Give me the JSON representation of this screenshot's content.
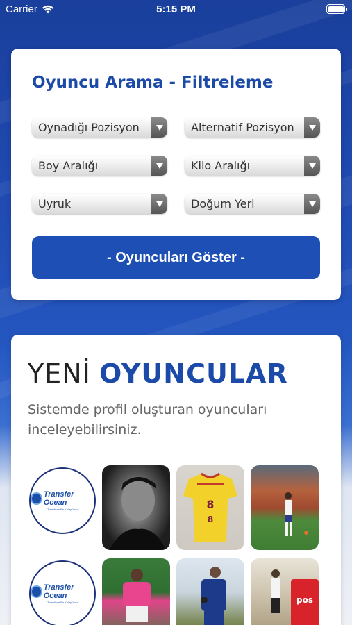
{
  "status_bar": {
    "carrier": "Carrier",
    "time": "5:15 PM"
  },
  "filter": {
    "title": "Oyuncu Arama - Filtreleme",
    "dropdowns": [
      {
        "label": "Oynadığı Pozisyon"
      },
      {
        "label": "Alternatif Pozisyon"
      },
      {
        "label": "Boy Aralığı"
      },
      {
        "label": "Kilo Aralığı"
      },
      {
        "label": "Uyruk"
      },
      {
        "label": "Doğum Yeri"
      }
    ],
    "show_button": "- Oyuncuları Göster -"
  },
  "new_players": {
    "heading_light": "YENİ",
    "heading_bold": "OYUNCULAR",
    "description": "Sistemde profil oluşturan oyuncuları inceleyebilirsiniz.",
    "logo": {
      "name": "Transfer Ocean",
      "tagline": "\"Transferin En Kolay Yolu\""
    },
    "players": [
      {
        "photo": "black-white-portrait"
      },
      {
        "photo": "yellow-jersey-8"
      },
      {
        "photo": "stadium-player"
      },
      {
        "photo": "pink-kit-player"
      },
      {
        "photo": "blue-kit-player"
      },
      {
        "photo": "player-with-red-sign"
      }
    ]
  },
  "colors": {
    "accent": "#1c4aa8",
    "button": "#1e4fb5",
    "background": "#1f4ab0"
  }
}
